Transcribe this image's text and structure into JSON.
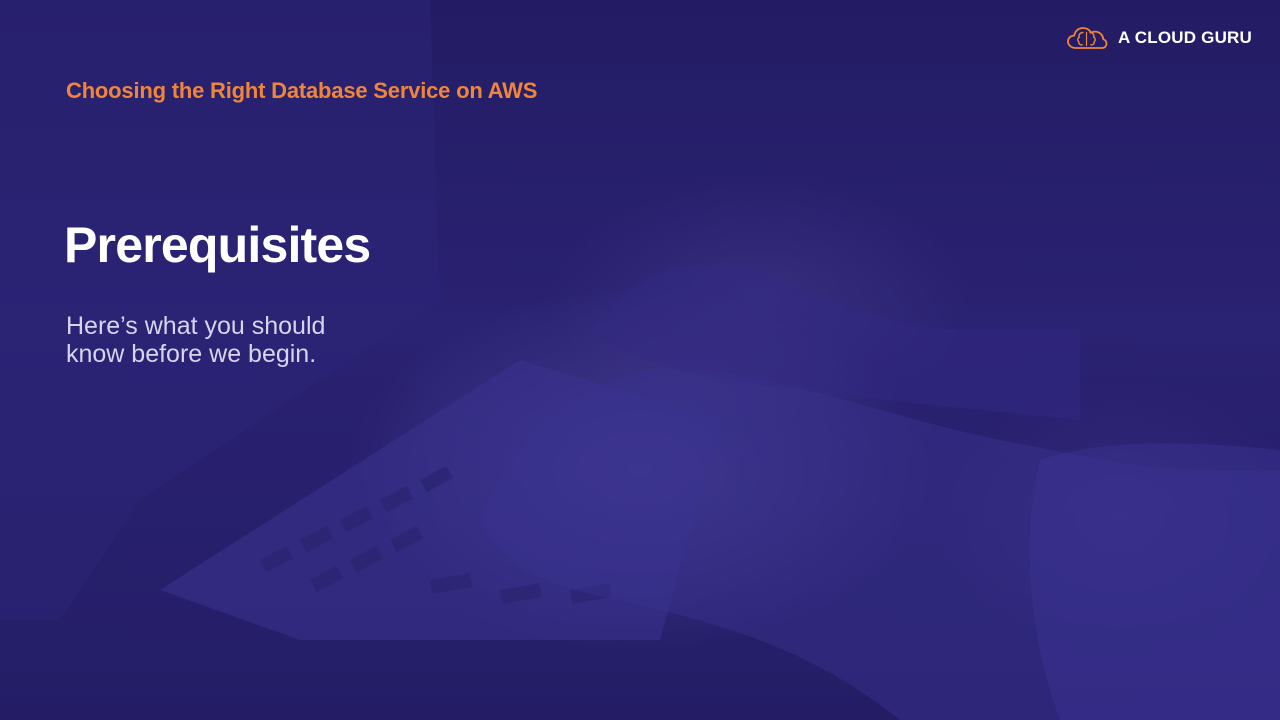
{
  "brand": {
    "name": "A CLOUD GURU",
    "logo_icon": "cloud-brain-icon",
    "logo_color": "#f0853a"
  },
  "course": {
    "title": "Choosing the Right Database Service on AWS"
  },
  "slide": {
    "heading": "Prerequisites",
    "subtitle_line1": "Here’s what you should",
    "subtitle_line2": "know before we begin."
  },
  "colors": {
    "background": "#2a2272",
    "accent": "#f0853a",
    "heading": "#ffffff",
    "subtitle": "#d8d4ee"
  }
}
